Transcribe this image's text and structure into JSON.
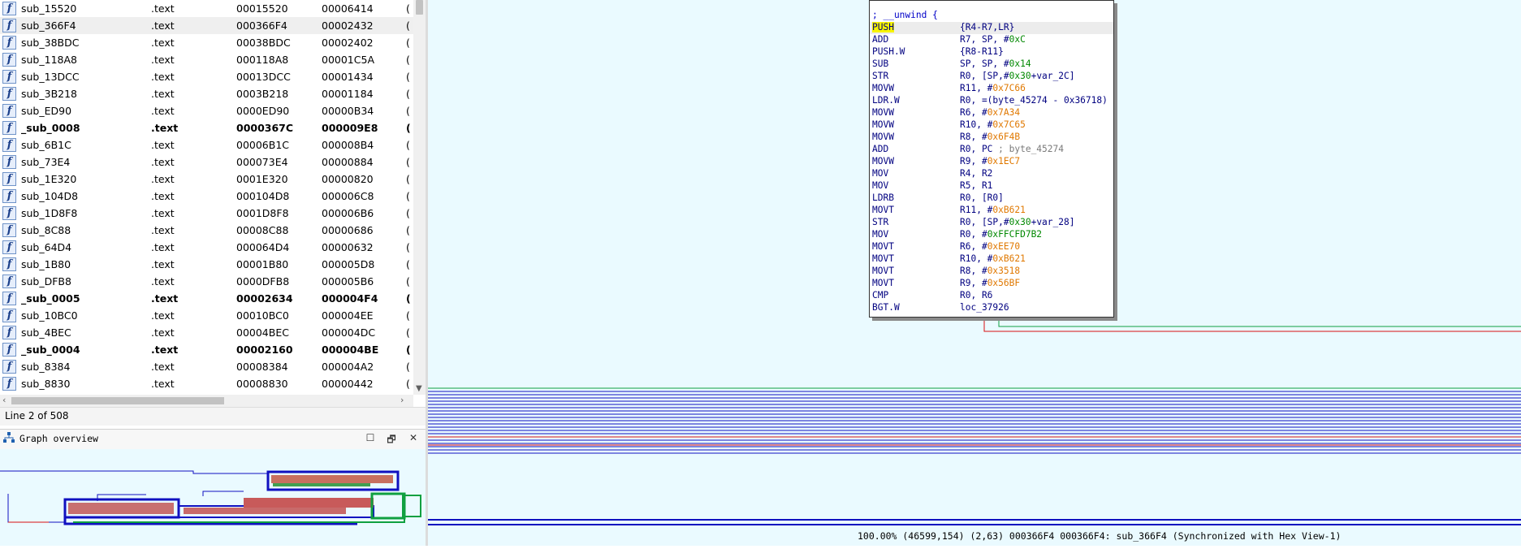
{
  "functions": {
    "rows": [
      {
        "name": "sub_15520",
        "segment": ".text",
        "start": "00015520",
        "length": "00006414",
        "more": "(",
        "bold": false
      },
      {
        "name": "sub_366F4",
        "segment": ".text",
        "start": "000366F4",
        "length": "00002432",
        "more": "(",
        "bold": false,
        "selected": true
      },
      {
        "name": "sub_38BDC",
        "segment": ".text",
        "start": "00038BDC",
        "length": "00002402",
        "more": "(",
        "bold": false
      },
      {
        "name": "sub_118A8",
        "segment": ".text",
        "start": "000118A8",
        "length": "00001C5A",
        "more": "(",
        "bold": false
      },
      {
        "name": "sub_13DCC",
        "segment": ".text",
        "start": "00013DCC",
        "length": "00001434",
        "more": "(",
        "bold": false
      },
      {
        "name": "sub_3B218",
        "segment": ".text",
        "start": "0003B218",
        "length": "00001184",
        "more": "(",
        "bold": false
      },
      {
        "name": "sub_ED90",
        "segment": ".text",
        "start": "0000ED90",
        "length": "00000B34",
        "more": "(",
        "bold": false
      },
      {
        "name": "_sub_0008",
        "segment": ".text",
        "start": "0000367C",
        "length": "000009E8",
        "more": "(",
        "bold": true
      },
      {
        "name": "sub_6B1C",
        "segment": ".text",
        "start": "00006B1C",
        "length": "000008B4",
        "more": "(",
        "bold": false
      },
      {
        "name": "sub_73E4",
        "segment": ".text",
        "start": "000073E4",
        "length": "00000884",
        "more": "(",
        "bold": false
      },
      {
        "name": "sub_1E320",
        "segment": ".text",
        "start": "0001E320",
        "length": "00000820",
        "more": "(",
        "bold": false
      },
      {
        "name": "sub_104D8",
        "segment": ".text",
        "start": "000104D8",
        "length": "000006C8",
        "more": "(",
        "bold": false
      },
      {
        "name": "sub_1D8F8",
        "segment": ".text",
        "start": "0001D8F8",
        "length": "000006B6",
        "more": "(",
        "bold": false
      },
      {
        "name": "sub_8C88",
        "segment": ".text",
        "start": "00008C88",
        "length": "00000686",
        "more": "(",
        "bold": false
      },
      {
        "name": "sub_64D4",
        "segment": ".text",
        "start": "000064D4",
        "length": "00000632",
        "more": "(",
        "bold": false
      },
      {
        "name": "sub_1B80",
        "segment": ".text",
        "start": "00001B80",
        "length": "000005D8",
        "more": "(",
        "bold": false
      },
      {
        "name": "sub_DFB8",
        "segment": ".text",
        "start": "0000DFB8",
        "length": "000005B6",
        "more": "(",
        "bold": false
      },
      {
        "name": "_sub_0005",
        "segment": ".text",
        "start": "00002634",
        "length": "000004F4",
        "more": "(",
        "bold": true
      },
      {
        "name": "sub_10BC0",
        "segment": ".text",
        "start": "00010BC0",
        "length": "000004EE",
        "more": "(",
        "bold": false
      },
      {
        "name": "sub_4BEC",
        "segment": ".text",
        "start": "00004BEC",
        "length": "000004DC",
        "more": "(",
        "bold": false
      },
      {
        "name": "_sub_0004",
        "segment": ".text",
        "start": "00002160",
        "length": "000004BE",
        "more": "(",
        "bold": true
      },
      {
        "name": "sub_8384",
        "segment": ".text",
        "start": "00008384",
        "length": "000004A2",
        "more": "(",
        "bold": false
      },
      {
        "name": "sub_8830",
        "segment": ".text",
        "start": "00008830",
        "length": "00000442",
        "more": "(",
        "bold": false
      }
    ],
    "icon_glyph": "f",
    "status": "Line 2 of 508"
  },
  "graph_overview": {
    "title": "Graph overview",
    "buttons": {
      "maximize": "☐",
      "restore": "🗗",
      "close": "✕"
    }
  },
  "disasm": {
    "comment": "; __unwind {",
    "lines": [
      {
        "mn": "PUSH",
        "hl": true,
        "parts": [
          {
            "t": "{R4-R7,LR}",
            "c": ""
          }
        ]
      },
      {
        "mn": "ADD",
        "parts": [
          {
            "t": "R7, SP, #",
            "c": ""
          },
          {
            "t": "0xC",
            "c": "gr"
          }
        ]
      },
      {
        "mn": "PUSH.W",
        "parts": [
          {
            "t": "{R8-R11}",
            "c": ""
          }
        ]
      },
      {
        "mn": "SUB",
        "parts": [
          {
            "t": "SP, SP, #",
            "c": ""
          },
          {
            "t": "0x14",
            "c": "gr"
          }
        ]
      },
      {
        "mn": "STR",
        "parts": [
          {
            "t": "R0, [SP,#",
            "c": ""
          },
          {
            "t": "0x30",
            "c": "gr"
          },
          {
            "t": "+var_2C]",
            "c": ""
          }
        ]
      },
      {
        "mn": "MOVW",
        "parts": [
          {
            "t": "R11, #",
            "c": ""
          },
          {
            "t": "0x7C66",
            "c": "num"
          }
        ]
      },
      {
        "mn": "LDR.W",
        "parts": [
          {
            "t": "R0, =(byte_45274 - 0x36718)",
            "c": ""
          }
        ]
      },
      {
        "mn": "MOVW",
        "parts": [
          {
            "t": "R6, #",
            "c": ""
          },
          {
            "t": "0x7A34",
            "c": "num"
          }
        ]
      },
      {
        "mn": "MOVW",
        "parts": [
          {
            "t": "R10, #",
            "c": ""
          },
          {
            "t": "0x7C65",
            "c": "num"
          }
        ]
      },
      {
        "mn": "MOVW",
        "parts": [
          {
            "t": "R8, #",
            "c": ""
          },
          {
            "t": "0x6F4B",
            "c": "num"
          }
        ]
      },
      {
        "mn": "ADD",
        "parts": [
          {
            "t": "R0, PC  ",
            "c": ""
          },
          {
            "t": "; byte_45274",
            "c": "cm"
          }
        ]
      },
      {
        "mn": "MOVW",
        "parts": [
          {
            "t": "R9, #",
            "c": ""
          },
          {
            "t": "0x1EC7",
            "c": "num"
          }
        ]
      },
      {
        "mn": "MOV",
        "parts": [
          {
            "t": "R4, R2",
            "c": ""
          }
        ]
      },
      {
        "mn": "MOV",
        "parts": [
          {
            "t": "R5, R1",
            "c": ""
          }
        ]
      },
      {
        "mn": "LDRB",
        "parts": [
          {
            "t": "R0, [R0]",
            "c": ""
          }
        ]
      },
      {
        "mn": "MOVT",
        "parts": [
          {
            "t": "R11, #",
            "c": ""
          },
          {
            "t": "0xB621",
            "c": "num"
          }
        ]
      },
      {
        "mn": "STR",
        "parts": [
          {
            "t": "R0, [SP,#",
            "c": ""
          },
          {
            "t": "0x30",
            "c": "gr"
          },
          {
            "t": "+var_28]",
            "c": ""
          }
        ]
      },
      {
        "mn": "MOV",
        "parts": [
          {
            "t": "R0, #",
            "c": ""
          },
          {
            "t": "0xFFCFD7B2",
            "c": "gr"
          }
        ]
      },
      {
        "mn": "MOVT",
        "parts": [
          {
            "t": "R6, #",
            "c": ""
          },
          {
            "t": "0xEE70",
            "c": "num"
          }
        ]
      },
      {
        "mn": "MOVT",
        "parts": [
          {
            "t": "R10, #",
            "c": ""
          },
          {
            "t": "0xB621",
            "c": "num"
          }
        ]
      },
      {
        "mn": "MOVT",
        "parts": [
          {
            "t": "R8, #",
            "c": ""
          },
          {
            "t": "0x3518",
            "c": "num"
          }
        ]
      },
      {
        "mn": "MOVT",
        "parts": [
          {
            "t": "R9, #",
            "c": ""
          },
          {
            "t": "0x56BF",
            "c": "num"
          }
        ]
      },
      {
        "mn": "CMP",
        "parts": [
          {
            "t": "R0, R6",
            "c": ""
          }
        ]
      },
      {
        "mn": "BGT.W",
        "parts": [
          {
            "t": "loc_37926",
            "c": ""
          }
        ]
      }
    ]
  },
  "status_bar": "100.00% (46599,154) (2,63) 000366F4 000366F4: sub_366F4 (Synchronized with Hex View-1)",
  "colors": {
    "graph_bg": "#eafaff",
    "edge_blue": "#1010c0",
    "edge_red": "#d81010",
    "edge_green": "#10a040",
    "highlight": "#f7f300"
  }
}
